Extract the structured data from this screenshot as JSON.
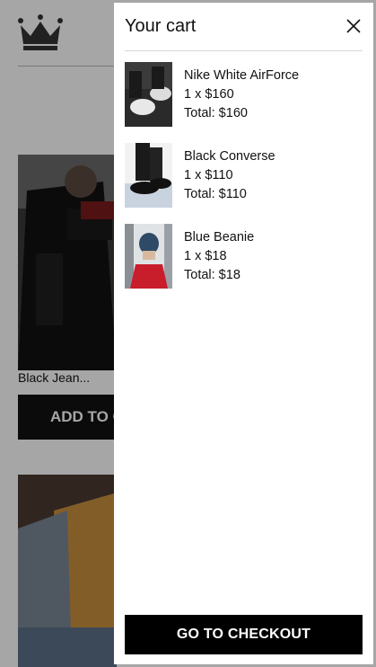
{
  "store": {
    "products": [
      {
        "title": "Black Jean...",
        "add_label": "ADD TO CART"
      },
      {
        "title": ""
      }
    ]
  },
  "cart": {
    "title": "Your cart",
    "items": [
      {
        "name": "Nike White AirForce",
        "qty_price": "1 x $160",
        "total": "Total: $160"
      },
      {
        "name": "Black Converse",
        "qty_price": "1 x $110",
        "total": "Total: $110"
      },
      {
        "name": "Blue Beanie",
        "qty_price": "1 x $18",
        "total": "Total: $18"
      }
    ],
    "checkout_label": "GO TO CHECKOUT"
  },
  "icons": {
    "logo": "crown-icon",
    "close": "close-icon"
  }
}
